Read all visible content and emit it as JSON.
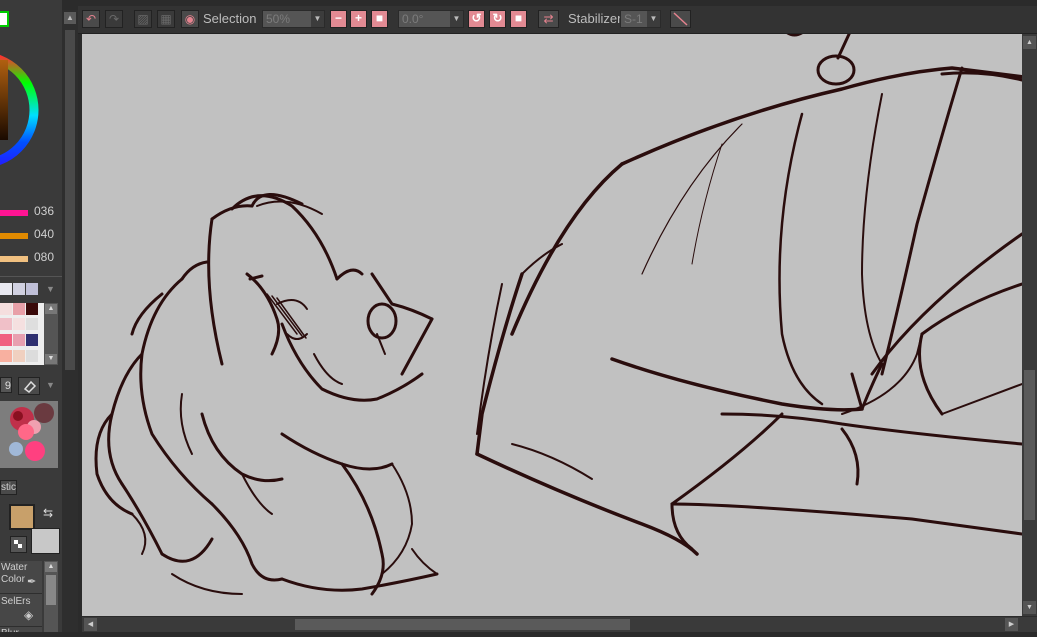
{
  "toolbar": {
    "undo_icon": "undo-icon",
    "redo_icon": "redo-icon",
    "selection_label": "Selection",
    "selection_zoom": "50%",
    "rotation_value": "0.0°",
    "stabilizer_label": "Stabilizer",
    "stabilizer_value": "S-1"
  },
  "color_panel": {
    "values": [
      "036",
      "040",
      "080"
    ],
    "slider_colors": [
      "#ff1493",
      "#e08a00",
      "#f0c080"
    ]
  },
  "brush_panel": {
    "size_value": "9",
    "brush_name_partial": "stic",
    "main_color": "#c8a06a",
    "sub_color": "#c8c8c8",
    "tools": [
      {
        "line1": "Water",
        "line2": "Color"
      },
      {
        "line1": "SelErs",
        "line2": ""
      },
      {
        "line1": "Blur",
        "line2": ""
      }
    ]
  },
  "canvas": {
    "background": "#c1c1c1",
    "line_color": "#2a0d0d",
    "scroll_v_fraction": 0.58,
    "scroll_h_fraction": 0.36
  }
}
